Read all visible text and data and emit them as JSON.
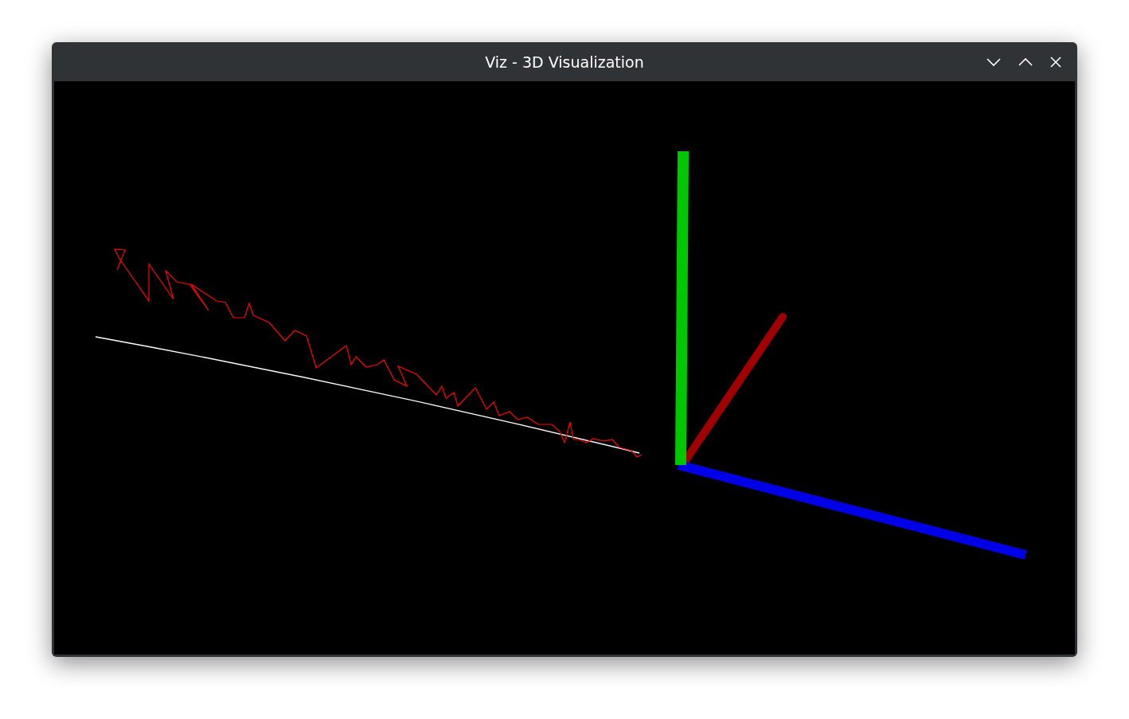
{
  "window": {
    "title": "Viz - 3D Visualization"
  }
}
